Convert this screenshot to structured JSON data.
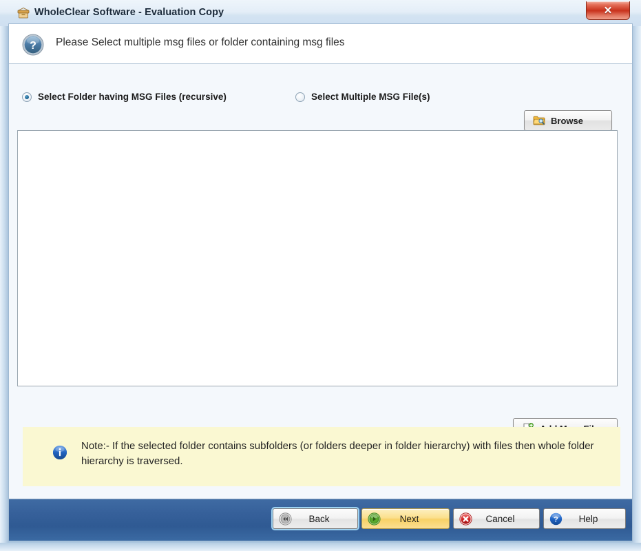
{
  "window": {
    "title": "WholeClear Software - Evaluation Copy",
    "app_icon": "archive-box-icon",
    "close_label": "✕"
  },
  "header": {
    "icon": "question-mark-icon",
    "instruction": "Please Select multiple msg files or folder containing msg files"
  },
  "options": {
    "items": [
      {
        "label": "Select Folder having MSG Files (recursive)",
        "selected": true,
        "name": "radio-select-folder-recursive"
      },
      {
        "label": "Select Multiple MSG File(s)",
        "selected": false,
        "name": "radio-select-multiple-files"
      }
    ],
    "browse_label": "Browse",
    "browse_icon": "folder-search-icon"
  },
  "file_list": {
    "items": [],
    "empty": true
  },
  "add_more": {
    "label": "Add More Files",
    "icon": "page-plus-icon"
  },
  "note": {
    "icon": "info-icon",
    "text": "Note:- If the selected folder contains subfolders (or folders deeper in folder hierarchy) with files then whole folder hierarchy is traversed."
  },
  "footer": {
    "buttons": [
      {
        "label": "Back",
        "icon": "rewind-icon",
        "name": "back-button"
      },
      {
        "label": "Next",
        "icon": "play-arrow-icon",
        "name": "next-button"
      },
      {
        "label": "Cancel",
        "icon": "red-x-circle-icon",
        "name": "cancel-button"
      },
      {
        "label": "Help",
        "icon": "question-circle-icon",
        "name": "help-button"
      }
    ]
  },
  "colors": {
    "titlebar": "#e4eef8",
    "footer_bar": "#36609a",
    "note_bg": "#faf8d2",
    "next_accent": "#f8d267",
    "close_red": "#c8321c",
    "radio_blue": "#19618f"
  }
}
